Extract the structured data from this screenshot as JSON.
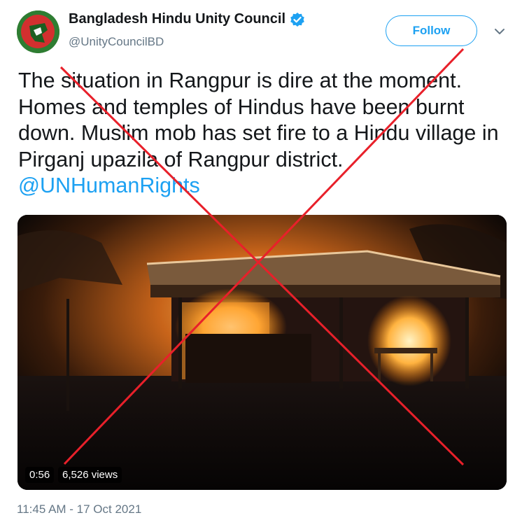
{
  "account": {
    "display_name": "Bangladesh Hindu Unity Council",
    "handle": "@UnityCouncilBD",
    "verified": true,
    "verified_icon": "verified-badge-icon"
  },
  "actions": {
    "follow_label": "Follow",
    "menu_icon": "chevron-down-icon"
  },
  "tweet": {
    "text": "The situation in Rangpur is dire at the moment. Homes and temples of Hindus have been burnt down. Muslim mob has set fire to a Hindu village in Pirganj upazila of Rangpur district.",
    "mention": "@UNHumanRights",
    "timestamp": "11:45 AM - 17 Oct 2021"
  },
  "media": {
    "type": "video",
    "duration": "0:56",
    "views": "6,526 views"
  },
  "colors": {
    "accent": "#1da1f2",
    "cross": "#e8202a",
    "muted": "#657786"
  }
}
